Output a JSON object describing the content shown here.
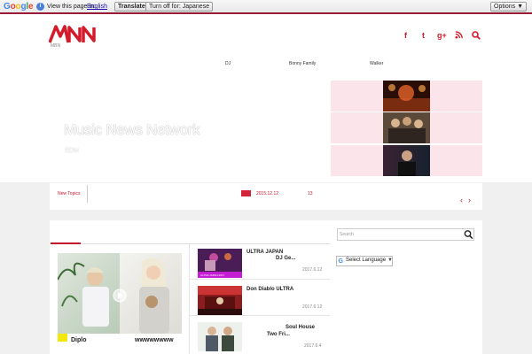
{
  "translate_bar": {
    "logo": "Google",
    "info_icon": "info-icon",
    "prompt": "View this page in:",
    "language": "English",
    "translate_label": "Translate",
    "turn_off_label": "Turn off for: Japanese",
    "options_label": "Options ▼"
  },
  "header": {
    "logo_text": "MNN",
    "logo_sub": "MBN",
    "social_icons": [
      "facebook-icon",
      "twitter-icon",
      "google-plus-icon",
      "rss-icon",
      "search-icon"
    ],
    "social_glyphs": [
      "f",
      "t",
      "g+",
      "◉",
      "⌕"
    ]
  },
  "nav": {
    "items": [
      "DJ",
      "Bonny Family",
      "Walker"
    ]
  },
  "hero": {
    "title": "Music News Network",
    "subtitle": "EDM"
  },
  "news_strip": {
    "label": "New Topics",
    "date": "2015.12.12",
    "count": "13",
    "prev": "‹",
    "next": "›"
  },
  "feature": {
    "title_left": "Diplo",
    "title_right": "wwwwwwww"
  },
  "articles": [
    {
      "title_line1": "ULTRA JAPAN",
      "title_line2": "DJ  Ge...",
      "date": "2017.6.12",
      "tag": "ULTRA JAPAN 2017"
    },
    {
      "title_line1": "Don Diablo      ULTRA",
      "title_line2": "",
      "date": "2017.6.12",
      "tag": ""
    },
    {
      "title_line1": "Soul House",
      "title_line2": "Two Fri...",
      "date": "2017.6.4",
      "tag": ""
    }
  ],
  "sidebar": {
    "search_placeholder": "Search",
    "language_label": "Select Language",
    "language_caret": "▼"
  },
  "colors": {
    "brand_red": "#d41b2c",
    "translate_border": "#9a1b37",
    "pink_panel": "#fbe4ea"
  }
}
